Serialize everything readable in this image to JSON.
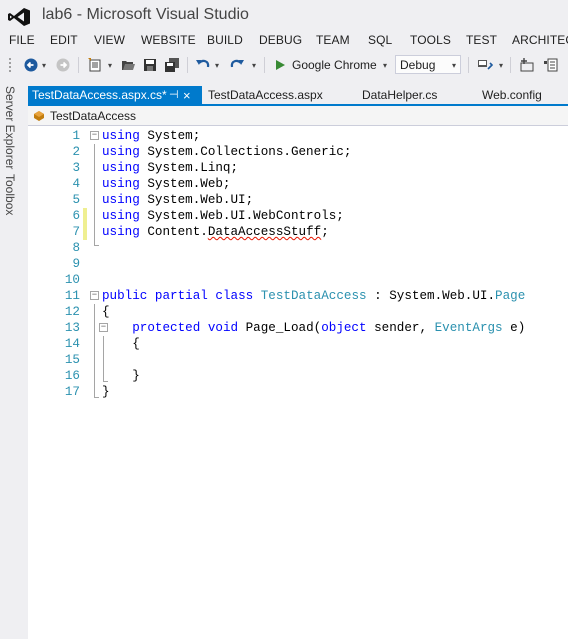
{
  "window": {
    "title": "lab6 - Microsoft Visual Studio"
  },
  "menu": [
    "FILE",
    "EDIT",
    "VIEW",
    "WEBSITE",
    "BUILD",
    "DEBUG",
    "TEAM",
    "SQL",
    "TOOLS",
    "TEST",
    "ARCHITEC"
  ],
  "toolbar": {
    "browser": "Google Chrome",
    "configuration": "Debug"
  },
  "side_panels": {
    "server_explorer": "Server Explorer",
    "toolbox": "Toolbox"
  },
  "tabs": [
    {
      "label": "TestDataAccess.aspx.cs*",
      "pin": "⊣",
      "close": "×"
    },
    {
      "label": "TestDataAccess.aspx"
    },
    {
      "label": "DataHelper.cs"
    },
    {
      "label": "Web.config"
    }
  ],
  "navigation": {
    "class_name": "TestDataAccess"
  },
  "code": {
    "lines": [
      {
        "n": "1",
        "t": [
          [
            "kw",
            "using"
          ],
          [
            "p",
            " System;"
          ]
        ]
      },
      {
        "n": "2",
        "t": [
          [
            "kw",
            "using"
          ],
          [
            "p",
            " System.Collections.Generic;"
          ]
        ]
      },
      {
        "n": "3",
        "t": [
          [
            "kw",
            "using"
          ],
          [
            "p",
            " System.Linq;"
          ]
        ]
      },
      {
        "n": "4",
        "t": [
          [
            "kw",
            "using"
          ],
          [
            "p",
            " System.Web;"
          ]
        ]
      },
      {
        "n": "5",
        "t": [
          [
            "kw",
            "using"
          ],
          [
            "p",
            " System.Web.UI;"
          ]
        ]
      },
      {
        "n": "6",
        "t": [
          [
            "kw",
            "using"
          ],
          [
            "p",
            " System.Web.UI.WebControls;"
          ]
        ]
      },
      {
        "n": "7",
        "t": [
          [
            "kw",
            "using"
          ],
          [
            "p",
            " Content."
          ],
          [
            "err",
            "DataAccessStuff"
          ],
          [
            "p",
            ";"
          ]
        ]
      },
      {
        "n": "8",
        "t": []
      },
      {
        "n": "9",
        "t": []
      },
      {
        "n": "10",
        "t": []
      },
      {
        "n": "11",
        "t": [
          [
            "kw",
            "public"
          ],
          [
            "p",
            " "
          ],
          [
            "kw",
            "partial"
          ],
          [
            "p",
            " "
          ],
          [
            "kw",
            "class"
          ],
          [
            "p",
            " "
          ],
          [
            "ty",
            "TestDataAccess"
          ],
          [
            "p",
            " : System.Web.UI."
          ],
          [
            "ty",
            "Page"
          ]
        ]
      },
      {
        "n": "12",
        "t": [
          [
            "p",
            "{"
          ]
        ]
      },
      {
        "n": "13",
        "t": [
          [
            "p",
            "    "
          ],
          [
            "kw",
            "protected"
          ],
          [
            "p",
            " "
          ],
          [
            "kw",
            "void"
          ],
          [
            "p",
            " Page_Load("
          ],
          [
            "kw",
            "object"
          ],
          [
            "p",
            " sender, "
          ],
          [
            "ty",
            "EventArgs"
          ],
          [
            "p",
            " e)"
          ]
        ]
      },
      {
        "n": "14",
        "t": [
          [
            "p",
            "    {"
          ]
        ]
      },
      {
        "n": "15",
        "t": []
      },
      {
        "n": "16",
        "t": [
          [
            "p",
            "    }"
          ]
        ]
      },
      {
        "n": "17",
        "t": [
          [
            "p",
            "}"
          ]
        ]
      }
    ],
    "modified_lines": [
      "6",
      "7"
    ]
  },
  "colors": {
    "accent": "#007acc",
    "keyword": "#0000ff",
    "type": "#2b91af",
    "line_number": "#2b91af",
    "change_marker": "#efef91",
    "error_squiggle": "#e51400"
  }
}
